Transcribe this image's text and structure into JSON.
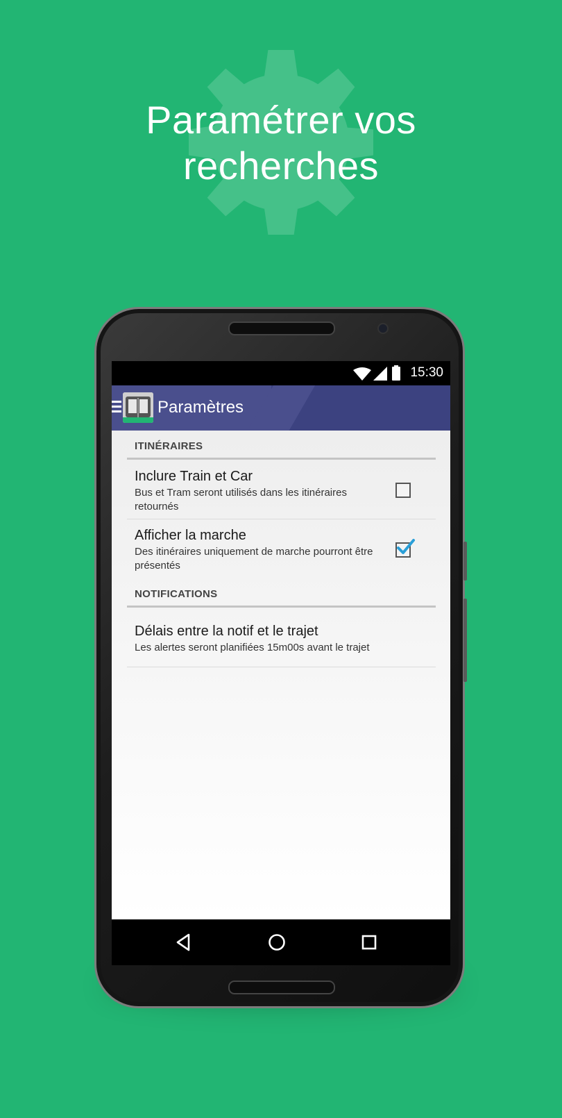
{
  "promo": {
    "title_line1": "Paramétrer vos",
    "title_line2": "recherches",
    "background_color": "#22b573",
    "icon": "gear-icon"
  },
  "status_bar": {
    "time": "15:30",
    "icons": [
      "wifi-icon",
      "signal-icon",
      "battery-icon"
    ]
  },
  "app_bar": {
    "title": "Paramètres",
    "color": "#3c4280",
    "icons": [
      "menu-icon",
      "app-logo-icon"
    ]
  },
  "settings": {
    "sections": [
      {
        "header": "ITINÉRAIRES",
        "items": [
          {
            "title": "Inclure Train et Car",
            "summary": "Bus et Tram seront utilisés dans les itinéraires retournés",
            "checked": false
          },
          {
            "title": "Afficher la marche",
            "summary": "Des itinéraires uniquement de marche pourront être présentés",
            "checked": true
          }
        ]
      },
      {
        "header": "NOTIFICATIONS",
        "items": [
          {
            "title": "Délais entre la notif et le trajet",
            "summary": "Les alertes seront planifiées 15m00s avant le trajet"
          }
        ]
      }
    ],
    "accent_color": "#2a9fd8"
  },
  "nav_bar": {
    "buttons": [
      "back-icon",
      "home-icon",
      "recents-icon"
    ]
  }
}
